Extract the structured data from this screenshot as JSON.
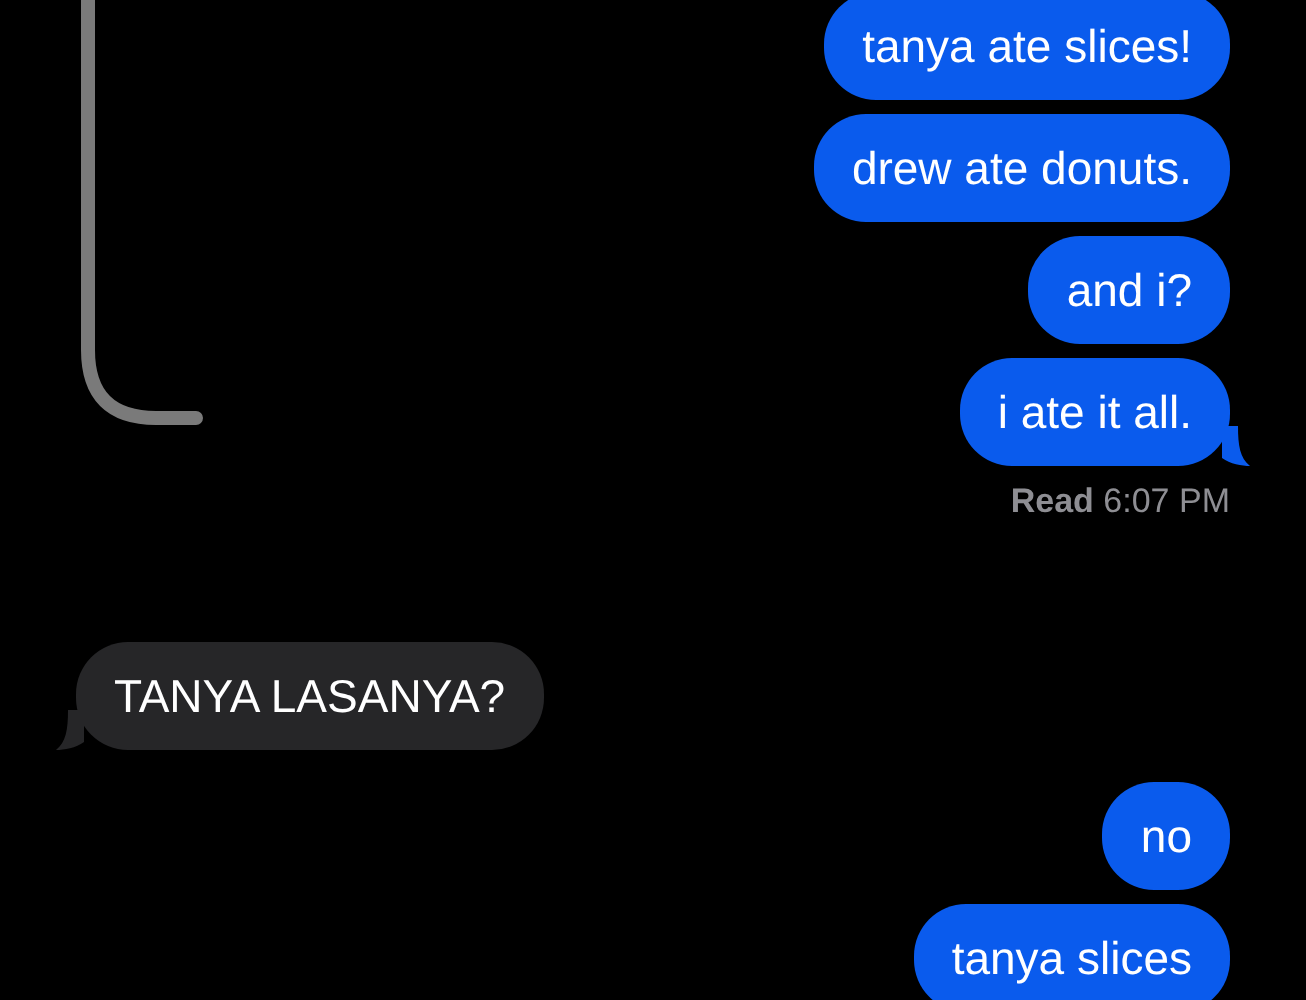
{
  "thread": [
    {
      "kind": "sent",
      "text": "tanya ate slices!",
      "tail": false
    },
    {
      "kind": "sent",
      "text": "drew ate donuts.",
      "tail": false
    },
    {
      "kind": "sent",
      "text": "and i?",
      "tail": false
    },
    {
      "kind": "sent",
      "text": "i ate it all.",
      "tail": true
    },
    {
      "kind": "receipt",
      "text": "**Read** 6:07 PM"
    },
    {
      "kind": "received",
      "text": "TANYA LASANYA?",
      "tail": true
    },
    {
      "kind": "sent",
      "text": "no",
      "tail": false
    },
    {
      "kind": "sent",
      "text": "tanya slices",
      "tail": false
    }
  ]
}
